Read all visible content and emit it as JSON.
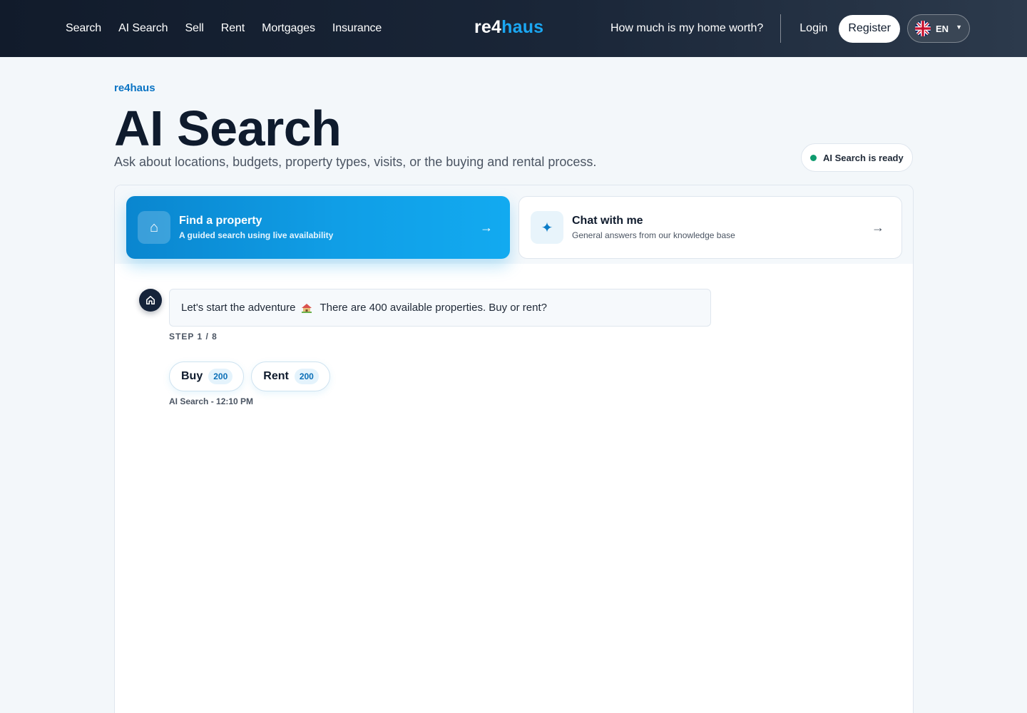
{
  "nav": {
    "links": [
      "Search",
      "AI Search",
      "Sell",
      "Rent",
      "Mortgages",
      "Insurance"
    ],
    "brand_part1": "re4",
    "brand_part2": "haus",
    "worth_link": "How much is my home worth?",
    "login": "Login",
    "register": "Register",
    "language": "EN"
  },
  "header": {
    "eyebrow": "re4haus",
    "title": "AI Search",
    "subtitle": "Ask about locations, budgets, property types, visits, or the buying and rental process.",
    "status": "AI Search is ready"
  },
  "modes": {
    "find": {
      "title": "Find a property",
      "description": "A guided search using live availability",
      "icon": "home-icon"
    },
    "chat": {
      "title": "Chat with me",
      "description": "General answers from our knowledge base",
      "icon": "sparkle-icon"
    }
  },
  "chat": {
    "message_part1": "Let's start the adventure",
    "message_part2": "There are 400 available properties. Buy or rent?",
    "step": "STEP 1 / 8",
    "options": [
      {
        "label": "Buy",
        "count": "200"
      },
      {
        "label": "Rent",
        "count": "200"
      }
    ],
    "meta": "AI Search - 12:10 PM"
  },
  "colors": {
    "nav_bg": "#111b2b",
    "accent": "#109ee6",
    "status_green": "#0f9b6e"
  }
}
